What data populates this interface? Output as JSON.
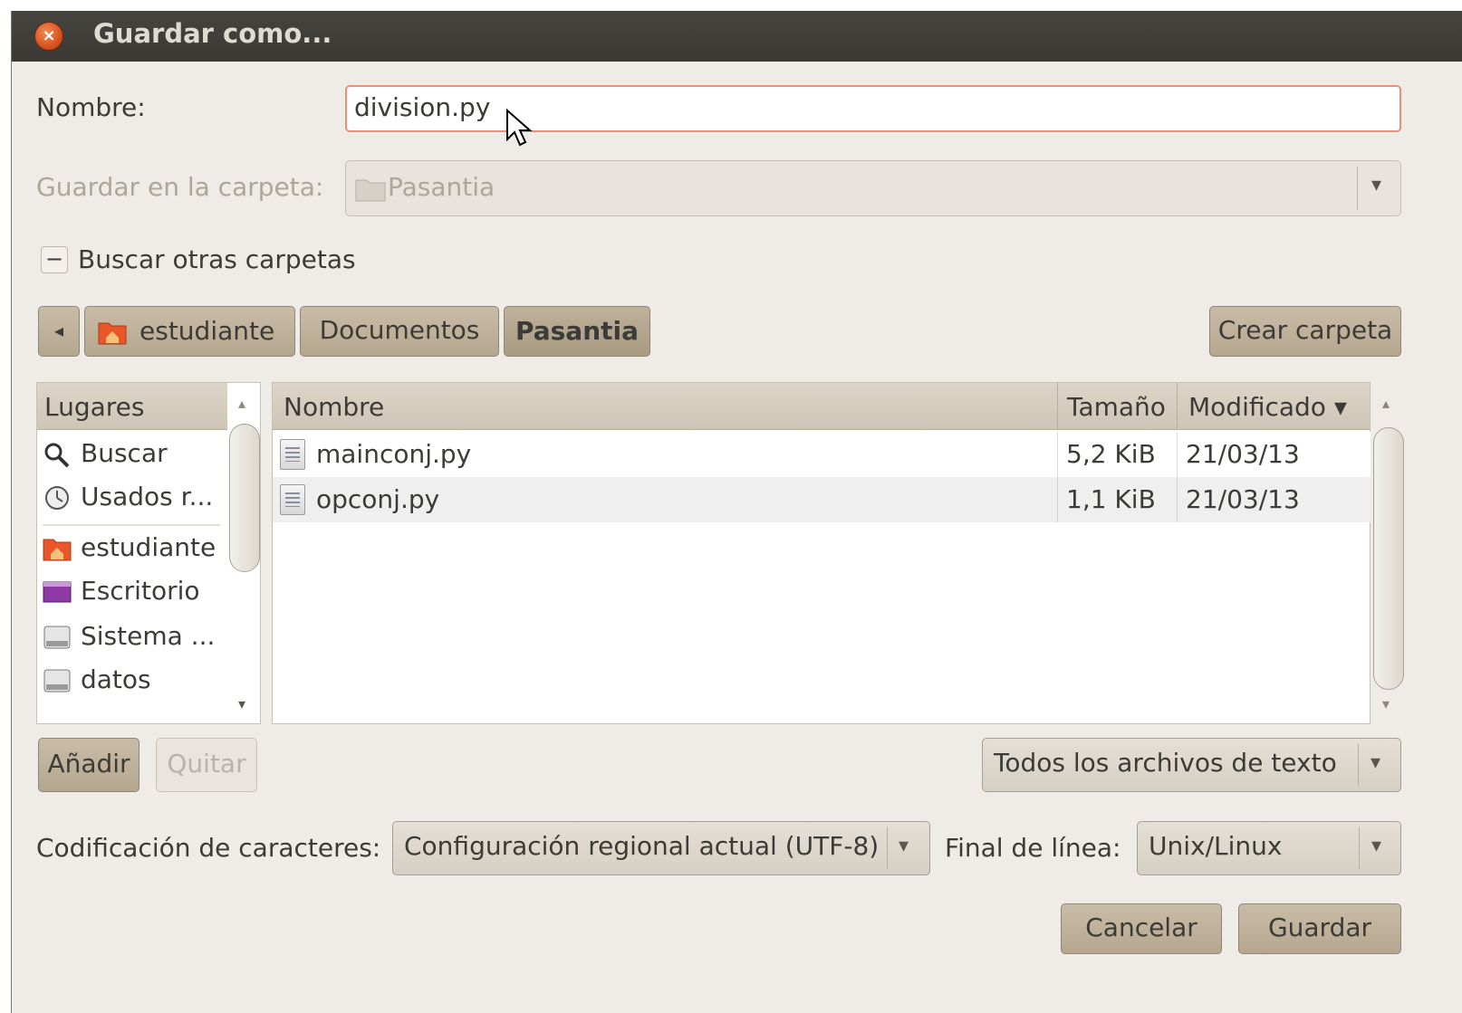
{
  "dialog": {
    "title": "Guardar como..."
  },
  "name_field": {
    "label": "Nombre:",
    "value": "division.py"
  },
  "folder": {
    "label": "Guardar en la carpeta:",
    "value": "Pasantia"
  },
  "expander": {
    "symbol": "−",
    "label": "Buscar otras carpetas"
  },
  "path_bar": {
    "back_arrow": "◂",
    "segments": [
      {
        "label": "estudiante",
        "icon": "home-folder-icon"
      },
      {
        "label": "Documentos"
      },
      {
        "label": "Pasantia",
        "active": true
      }
    ],
    "create_folder": "Crear carpeta"
  },
  "places": {
    "header": "Lugares",
    "items": [
      {
        "label": "Buscar",
        "icon": "search-icon"
      },
      {
        "label": "Usados r...",
        "icon": "recent-icon"
      },
      {
        "label": "estudiante",
        "icon": "home-folder-icon"
      },
      {
        "label": "Escritorio",
        "icon": "desktop-icon"
      },
      {
        "label": "Sistema ...",
        "icon": "drive-icon"
      },
      {
        "label": "datos",
        "icon": "drive-icon"
      }
    ],
    "add_button": "Añadir",
    "remove_button": "Quitar"
  },
  "files": {
    "columns": {
      "name": "Nombre",
      "size": "Tamaño",
      "modified": "Modificado ▾"
    },
    "rows": [
      {
        "name": "mainconj.py",
        "size": "5,2 KiB",
        "modified": "21/03/13"
      },
      {
        "name": "opconj.py",
        "size": "1,1 KiB",
        "modified": "21/03/13"
      }
    ]
  },
  "filter": {
    "value": "Todos los archivos de texto"
  },
  "encoding": {
    "label": "Codificación de caracteres:",
    "value": "Configuración regional actual (UTF-8)"
  },
  "line_ending": {
    "label": "Final de línea:",
    "value": "Unix/Linux"
  },
  "actions": {
    "cancel": "Cancelar",
    "save": "Guardar"
  },
  "colors": {
    "titlebar": "#3c3b37",
    "window_bg": "#efebe7",
    "button": "#c2b49c",
    "entry_focus": "#e98f7a"
  }
}
